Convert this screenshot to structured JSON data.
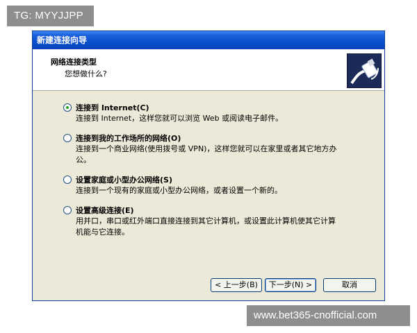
{
  "watermark_top": "TG: MYYJJPP",
  "watermark_bottom": "www.bet365-cnofficial.com",
  "window": {
    "title": "新建连接向导",
    "header_title": "网络连接类型",
    "header_subtitle": "您想做什么?",
    "header_icon": "network-cable-icon"
  },
  "options": [
    {
      "label": "连接到 Internet(C)",
      "desc": "连接到 Internet，这样您就可以浏览 Web 或阅读电子邮件。",
      "checked": true
    },
    {
      "label": "连接到我的工作场所的网络(O)",
      "desc": "连接到一个商业网络(使用拨号或 VPN)，这样您就可以在家里或者其它地方办公。",
      "checked": false
    },
    {
      "label": "设置家庭或小型办公网络(S)",
      "desc": "连接到一个现有的家庭或小型办公网络，或者设置一个新的。",
      "checked": false
    },
    {
      "label": "设置高级连接(E)",
      "desc": "用并口，串口或红外端口直接连接到其它计算机，或设置此计算机使其它计算机能与它连接。",
      "checked": false
    }
  ],
  "buttons": {
    "back": "< 上一步(B)",
    "next": "下一步(N) >",
    "cancel": "取消"
  }
}
